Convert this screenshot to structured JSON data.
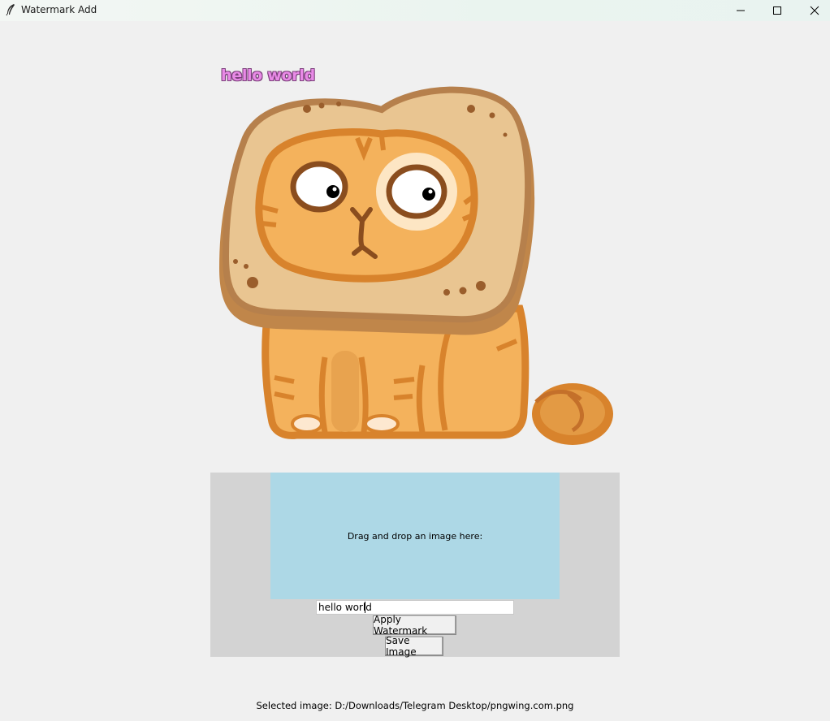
{
  "window": {
    "title": "Watermark Add",
    "icons": {
      "app": "feather-icon",
      "minimize": "minimize-icon",
      "maximize": "maximize-icon",
      "close": "close-icon"
    }
  },
  "preview": {
    "image_subject": "cartoon cat wearing bread slice",
    "watermark": "hello world",
    "watermark_color": "#e88ae6"
  },
  "panel": {
    "drop_zone_label": "Drag and drop an image here:",
    "watermark_input_value": "hello world",
    "apply_button": "Apply Watermark",
    "save_button": "Save Image"
  },
  "status": {
    "selected_image": "Selected image: D:/Downloads/Telegram Desktop/pngwing.com.png"
  },
  "colors": {
    "background": "#f0f0f0",
    "panel": "#d3d3d3",
    "drop_zone": "#add8e6"
  }
}
